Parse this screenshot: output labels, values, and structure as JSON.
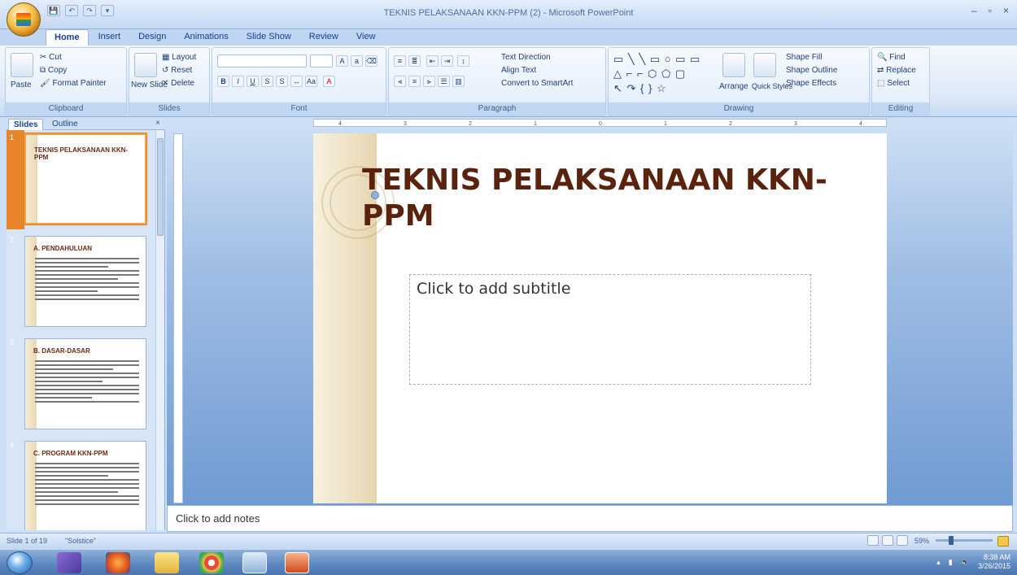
{
  "window": {
    "title": "TEKNIS PELAKSANAAN KKN-PPM (2) - Microsoft PowerPoint",
    "controls": [
      "–",
      "▫",
      "×"
    ]
  },
  "qat": [
    "💾",
    "↶",
    "↷",
    "▾"
  ],
  "tabs": [
    "Home",
    "Insert",
    "Design",
    "Animations",
    "Slide Show",
    "Review",
    "View"
  ],
  "ribbon": {
    "clipboard": {
      "label": "Clipboard",
      "paste": "Paste",
      "cut": "Cut",
      "copy": "Copy",
      "format_painter": "Format Painter"
    },
    "slides": {
      "label": "Slides",
      "new_slide": "New Slide",
      "layout": "Layout",
      "reset": "Reset",
      "delete": "Delete"
    },
    "font": {
      "label": "Font"
    },
    "paragraph": {
      "label": "Paragraph",
      "text_direction": "Text Direction",
      "align_text": "Align Text",
      "convert_smartart": "Convert to SmartArt"
    },
    "drawing": {
      "label": "Drawing",
      "arrange": "Arrange",
      "quick_styles": "Quick Styles",
      "shape_fill": "Shape Fill",
      "shape_outline": "Shape Outline",
      "shape_effects": "Shape Effects"
    },
    "editing": {
      "label": "Editing",
      "find": "Find",
      "replace": "Replace",
      "select": "Select"
    }
  },
  "left_pane": {
    "tabs": [
      "Slides",
      "Outline"
    ],
    "close": "×",
    "thumbnails": [
      {
        "num": "1",
        "title": "TEKNIS PELAKSANAAN KKN-PPM"
      },
      {
        "num": "2",
        "title": "A. PENDAHULUAN"
      },
      {
        "num": "3",
        "title": "B. DASAR-DASAR"
      },
      {
        "num": "4",
        "title": "C. PROGRAM KKN-PPM"
      }
    ]
  },
  "ruler_ticks": [
    "4",
    "3",
    "2",
    "1",
    "0",
    "1",
    "2",
    "3",
    "4"
  ],
  "slide": {
    "title": "TEKNIS PELAKSANAAN KKN-PPM",
    "subtitle_placeholder": "Click to add subtitle"
  },
  "notes_placeholder": "Click to add notes",
  "status": {
    "slide_info": "Slide 1 of 19",
    "theme": "\"Solstice\"",
    "zoom": "59%"
  },
  "clock": {
    "time": "8:38 AM",
    "date": "3/26/2015"
  }
}
